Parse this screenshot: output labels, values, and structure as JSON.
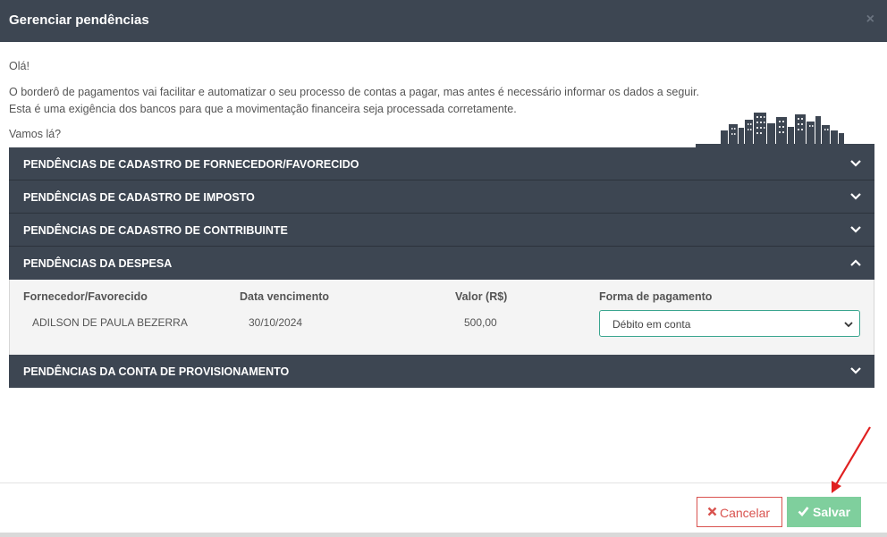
{
  "modal": {
    "title": "Gerenciar pendências",
    "close_icon": "close-icon"
  },
  "intro": {
    "greeting": "Olá!",
    "paragraph_line1": "O borderô de pagamentos vai facilitar e automatizar o seu processo de contas a pagar, mas antes é necessário informar os dados a seguir.",
    "paragraph_line2": "Esta é uma exigência dos bancos para que a movimentação financeira seja processada corretamente.",
    "prompt": "Vamos lá?"
  },
  "panels": [
    {
      "label": "PENDÊNCIAS DE CADASTRO DE FORNECEDOR/FAVORECIDO",
      "expanded": false,
      "icon": "chevron-down-icon"
    },
    {
      "label": "PENDÊNCIAS DE CADASTRO DE IMPOSTO",
      "expanded": false,
      "icon": "chevron-down-icon"
    },
    {
      "label": "PENDÊNCIAS DE CADASTRO DE CONTRIBUINTE",
      "expanded": false,
      "icon": "chevron-down-icon"
    },
    {
      "label": "PENDÊNCIAS DA DESPESA",
      "expanded": true,
      "icon": "chevron-up-icon"
    },
    {
      "label": "PENDÊNCIAS DA CONTA DE PROVISIONAMENTO",
      "expanded": false,
      "icon": "chevron-down-icon"
    }
  ],
  "despesa_table": {
    "columns": [
      "Fornecedor/Favorecido",
      "Data vencimento",
      "Valor (R$)",
      "Forma de pagamento"
    ],
    "rows": [
      {
        "fornecedor": "ADILSON DE PAULA BEZERRA",
        "vencimento": "30/10/2024",
        "valor": "500,00",
        "forma_pagamento": "Débito em conta"
      }
    ]
  },
  "footer": {
    "cancel_label": "Cancelar",
    "save_label": "Salvar",
    "cancel_icon": "x-icon",
    "save_icon": "check-icon"
  },
  "colors": {
    "header_bg": "#3d4652",
    "cancel_red": "#d9534f",
    "save_green": "#7fcf9d",
    "select_border": "#3aa58f",
    "annotation_arrow": "#e02020"
  }
}
